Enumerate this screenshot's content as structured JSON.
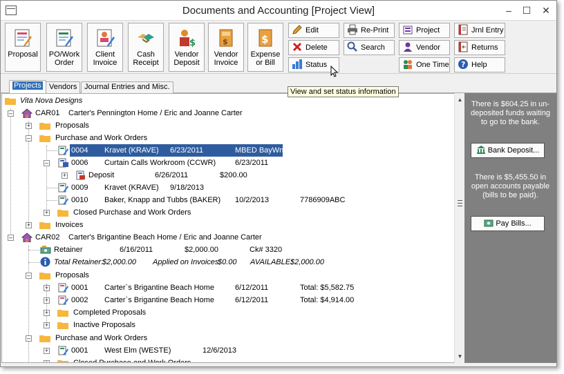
{
  "window": {
    "title": "Documents and Accounting [Project View]"
  },
  "toolbar": {
    "big_buttons": [
      {
        "label1": "Proposal",
        "label2": ""
      },
      {
        "label1": "PO/Work",
        "label2": "Order"
      },
      {
        "label1": "Client",
        "label2": "Invoice"
      },
      {
        "label1": "Cash",
        "label2": "Receipt"
      },
      {
        "label1": "Vendor",
        "label2": "Deposit"
      },
      {
        "label1": "Vendor",
        "label2": "Invoice"
      },
      {
        "label1": "Expense",
        "label2": "or Bill"
      }
    ],
    "edit": "Edit",
    "delete": "Delete",
    "status": "Status",
    "reprint": "Re-Print",
    "search": "Search",
    "project": "Project",
    "vendor": "Vendor",
    "one_time": "One Time",
    "jrnl_entry": "Jrnl Entry",
    "returns": "Returns",
    "help": "Help"
  },
  "tooltip": "View and set status information",
  "tabs": [
    "Projects",
    "Vendors",
    "Journal Entries and Misc."
  ],
  "tree": {
    "root": "Vita Nova Designs",
    "car01": {
      "code": "CAR01",
      "name": "Carter's Pennington Home / Eric and Joanne Carter"
    },
    "proposals": "Proposals",
    "po_wo": "Purchase and Work Orders",
    "row_0004": {
      "num": "0004",
      "vendor": "Kravet (KRAVE)",
      "date": "6/23/2011",
      "ref": "MBED BayWn"
    },
    "row_0006": {
      "num": "0006",
      "vendor": "Curtain Calls Workroom (CCWR)",
      "date": "6/23/2011"
    },
    "deposit": {
      "label": "Deposit",
      "date": "6/26/2011",
      "amount": "$200.00"
    },
    "row_0009": {
      "num": "0009",
      "vendor": "Kravet (KRAVE)",
      "date": "9/18/2013"
    },
    "row_0010": {
      "num": "0010",
      "vendor": "Baker, Knapp and Tubbs (BAKER)",
      "date": "10/2/2013",
      "ref": "7786909ABC"
    },
    "closed_po": "Closed Purchase and Work Orders",
    "invoices": "Invoices",
    "car02": {
      "code": "CAR02",
      "name": "Carter's Brigantine Beach Home / Eric and Joanne Carter"
    },
    "retainer": {
      "label": "Retainer",
      "date": "6/16/2011",
      "amount": "$2,000.00",
      "check": "Ck# 3320"
    },
    "total_retainer": {
      "label": "Total Retainer:",
      "value": "$2,000.00",
      "applied_label": "Applied on Invoices:",
      "applied": "$0.00",
      "available_label": "AVAILABLE:",
      "available": "$2,000.00"
    },
    "proposals2": "Proposals",
    "prop_0001": {
      "num": "0001",
      "name": "Carter`s Brigantine Beach Home",
      "date": "6/12/2011",
      "total": "Total: $5,582.75"
    },
    "prop_0002": {
      "num": "0002",
      "name": "Carter`s Brigantine Beach Home",
      "date": "6/12/2011",
      "total": "Total: $4,914.00"
    },
    "completed_proposals": "Completed Proposals",
    "inactive_proposals": "Inactive Proposals",
    "po_wo2": "Purchase and Work Orders",
    "po_0001": {
      "num": "0001",
      "vendor": "West Elm (WESTE)",
      "date": "12/6/2013"
    },
    "closed_po2": "Closed Purchase and Work Orders"
  },
  "side_panel": {
    "undeposited_msg": "There is $604.25 in un-deposited funds waiting to go to the bank.",
    "bank_deposit": "Bank Deposit...",
    "payable_msg": "There is $5,455.50 in open accounts payable (bills to be paid).",
    "pay_bills": "Pay Bills..."
  }
}
